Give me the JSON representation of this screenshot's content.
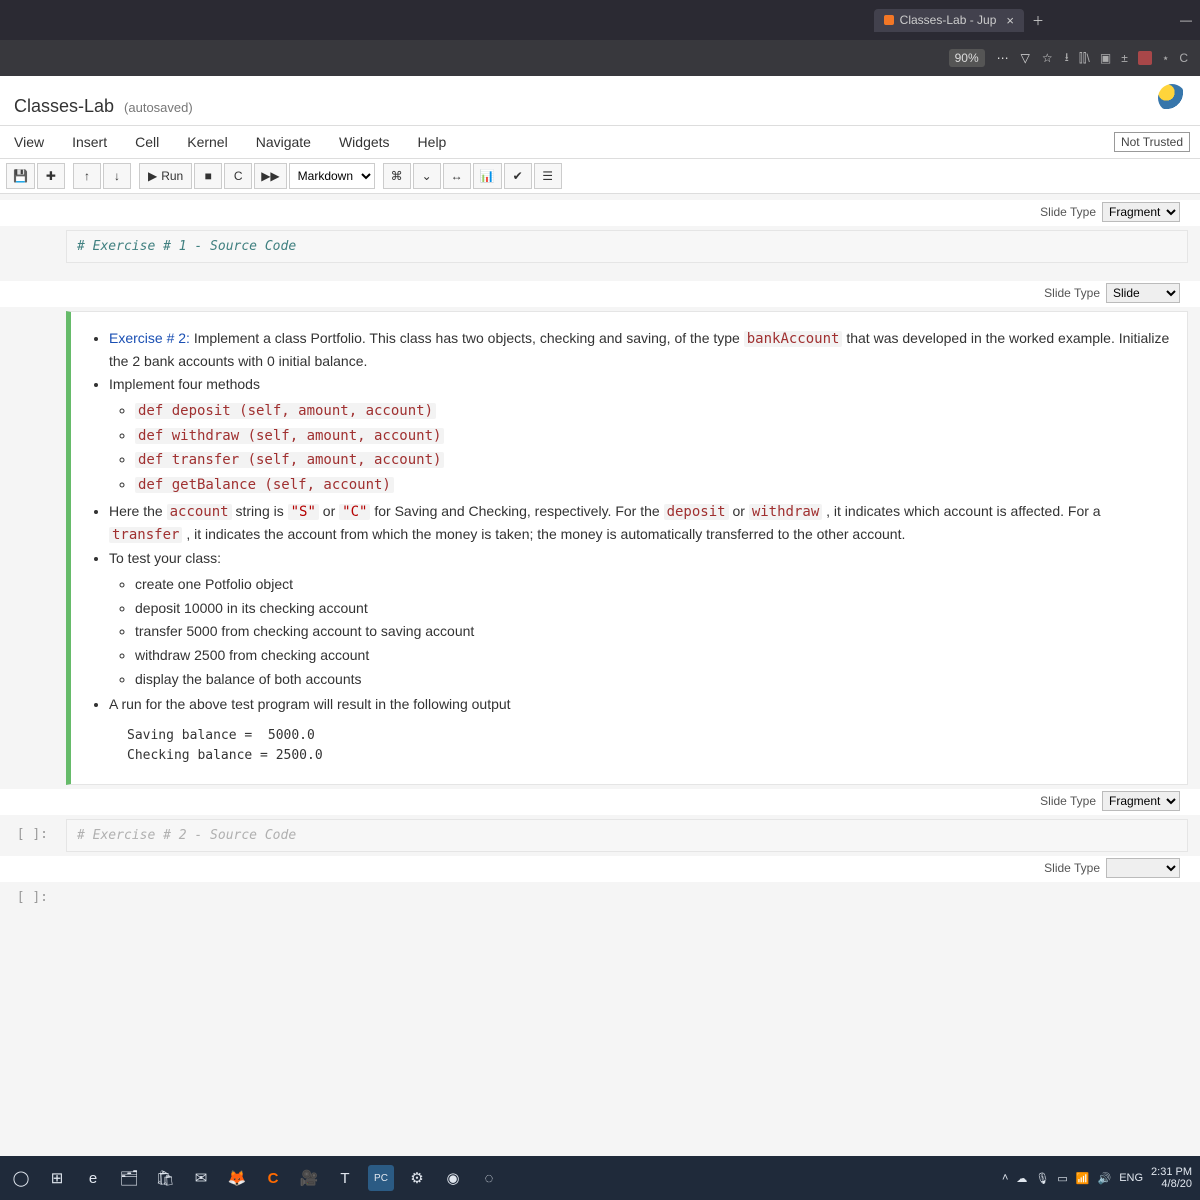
{
  "browser": {
    "tab_title": "Classes-Lab - Jup",
    "zoom": "90%",
    "icons": [
      "download-icon",
      "library-icon",
      "screenshot-icon",
      "addons-icon",
      "shield-icon",
      "menu-icon"
    ]
  },
  "notebook": {
    "title": "Classes-Lab",
    "autosaved": "(autosaved)",
    "trust": "Not Trusted",
    "cell_type": "Markdown"
  },
  "menus": [
    "View",
    "Insert",
    "Cell",
    "Kernel",
    "Navigate",
    "Widgets",
    "Help"
  ],
  "toolbar": {
    "run": "Run"
  },
  "slide_labels": {
    "label": "Slide Type"
  },
  "slide_values": {
    "cell1": "Fragment",
    "cell2a": "Slide",
    "cell2b": "Fragment",
    "cell3": ""
  },
  "cells": {
    "c1": {
      "prompt": "[ ]:",
      "code": "# Exercise # 1 - Source Code"
    },
    "c2": {
      "title": "Exercise # 2:",
      "intro_a": " Implement a class Portfolio. This class has two objects, checking and saving, of the type ",
      "intro_code": "bankAccount",
      "intro_b": " that was developed in the worked example. Initialize the 2 bank accounts with 0 initial balance.",
      "impl": "Implement four methods",
      "methods": [
        "def deposit (self, amount, account)",
        "def withdraw (self, amount, account)",
        "def transfer (self, amount, account)",
        "def getBalance (self, account)"
      ],
      "here_a": "Here the ",
      "here_acct": "account",
      "here_b": " string is ",
      "here_s": "\"S\"",
      "here_or": " or ",
      "here_c": "\"C\"",
      "here_d": " for Saving and Checking, respectively. For the ",
      "here_dep": "deposit",
      "here_e": " or ",
      "here_wd": "withdraw",
      "here_f": " , it indicates which account is affected. For a ",
      "here_tr": "transfer",
      "here_g": " , it indicates the account from which the money is taken; the money is automatically transferred to the other account.",
      "test_head": "To test your class:",
      "tests": [
        "create one Potfolio object",
        "deposit 10000 in its checking account",
        "transfer 5000 from checking account to saving account",
        "withdraw 2500 from checking account",
        "display the balance of both accounts"
      ],
      "run_line": "A run for the above test program will result in the following output",
      "output": "Saving balance =  5000.0\nChecking balance = 2500.0"
    },
    "c3": {
      "prompt": "[ ]:",
      "code": "# Exercise # 2 - Source Code"
    },
    "c4_prompt": "[ ]:"
  },
  "taskbar": {
    "lang": "ENG",
    "time": "2:31 PM",
    "date": "4/8/20"
  }
}
